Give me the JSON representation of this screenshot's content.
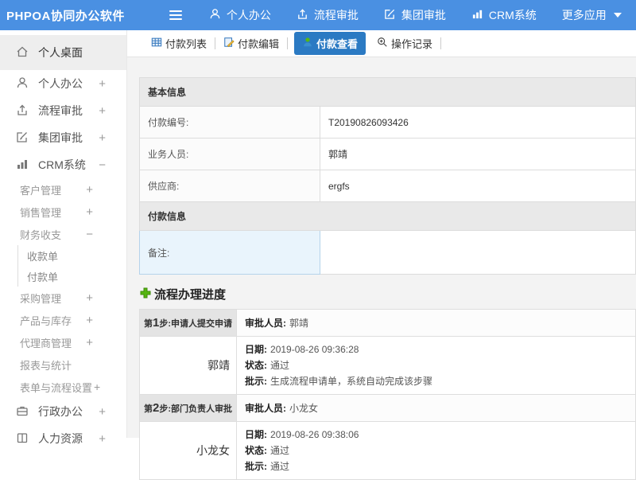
{
  "topbar": {
    "brand": "PHPOA协同办公软件",
    "nav": [
      {
        "label": "个人办公"
      },
      {
        "label": "流程审批"
      },
      {
        "label": "集团审批"
      },
      {
        "label": "CRM系统"
      },
      {
        "label": "更多应用"
      }
    ]
  },
  "sidebar": {
    "items": [
      {
        "label": "个人桌面"
      },
      {
        "label": "个人办公",
        "toggle": "+"
      },
      {
        "label": "流程审批",
        "toggle": "+"
      },
      {
        "label": "集团审批",
        "toggle": "+"
      },
      {
        "label": "CRM系统",
        "toggle": "−"
      },
      {
        "label": "客户管理",
        "toggle": "+"
      },
      {
        "label": "销售管理",
        "toggle": "+"
      },
      {
        "label": "财务收支",
        "toggle": "−"
      },
      {
        "label": "收款单"
      },
      {
        "label": "付款单"
      },
      {
        "label": "采购管理",
        "toggle": "+"
      },
      {
        "label": "产品与库存",
        "toggle": "+"
      },
      {
        "label": "代理商管理",
        "toggle": "+"
      },
      {
        "label": "报表与统计"
      },
      {
        "label": "表单与流程设置",
        "toggle": "+"
      },
      {
        "label": "行政办公",
        "toggle": "+"
      },
      {
        "label": "人力资源",
        "toggle": "+"
      }
    ]
  },
  "tabs": [
    {
      "label": "付款列表"
    },
    {
      "label": "付款编辑"
    },
    {
      "label": "付款查看",
      "active": true
    },
    {
      "label": "操作记录"
    }
  ],
  "basic_info": {
    "title": "基本信息",
    "rows": [
      {
        "label": "付款编号:",
        "value": "T20190826093426"
      },
      {
        "label": "业务人员:",
        "value": "郭靖"
      },
      {
        "label": "供应商:",
        "value": "ergfs"
      }
    ]
  },
  "payment_info": {
    "title": "付款信息",
    "remark_label": "备注:",
    "remark_value": ""
  },
  "progress": {
    "title": "流程办理进度",
    "labels": {
      "approver": "审批人员:",
      "date": "日期:",
      "status": "状态:",
      "comment": "批示:"
    },
    "steps": [
      {
        "prefix": "第",
        "num": "1",
        "suffix": "步:申请人提交申请",
        "approver": "郭靖",
        "name": "郭靖",
        "date": "2019-08-26 09:36:28",
        "status": "通过",
        "comment": "生成流程申请单，系统自动完成该步骤"
      },
      {
        "prefix": "第",
        "num": "2",
        "suffix": "步:部门负责人审批",
        "approver": "小龙女",
        "name": "小龙女",
        "date": "2019-08-26 09:38:06",
        "status": "通过",
        "comment": "通过"
      }
    ]
  },
  "colors": {
    "topbar_blue": "#4a90e2",
    "active_tab_blue": "#2b7ac3",
    "plus_green": "#55b510",
    "remark_highlight": "#e9f4fc"
  }
}
